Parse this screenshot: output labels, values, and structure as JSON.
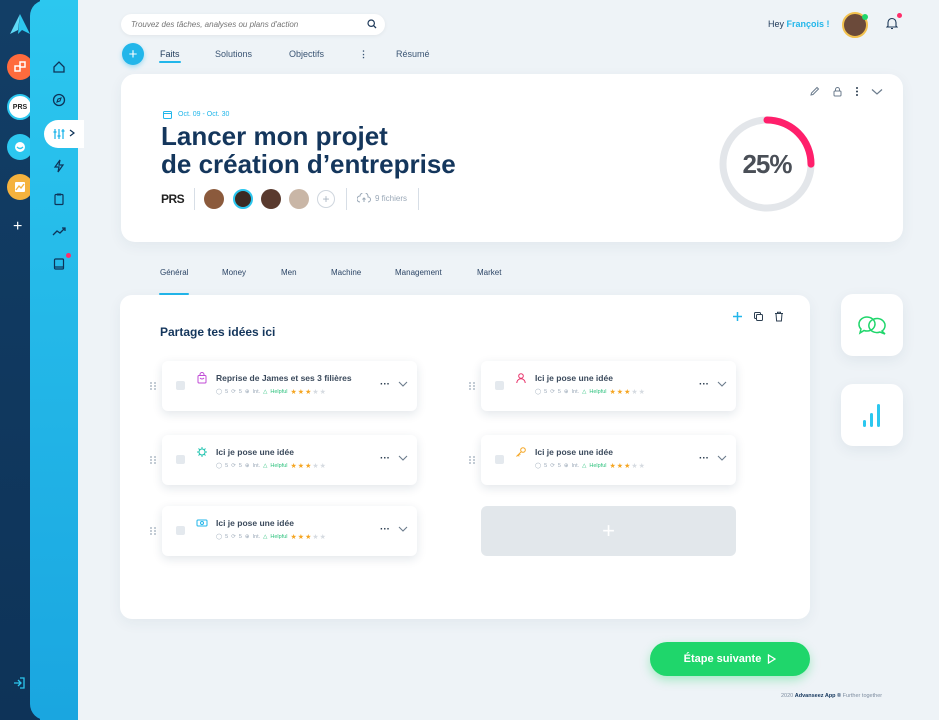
{
  "search": {
    "placeholder": "Trouvez des tâches, analyses ou plans d'action"
  },
  "header": {
    "greeting": "Hey",
    "user_name": "François !"
  },
  "top_tabs": [
    {
      "label": "Faits",
      "active": true
    },
    {
      "label": "Solutions",
      "active": false
    },
    {
      "label": "Objectifs",
      "active": false
    },
    {
      "label": "Résumé",
      "active": false
    }
  ],
  "rail_apps": [
    "PRS"
  ],
  "project": {
    "date_range": "Oct. 09 - Oct. 30",
    "title_line1": "Lancer mon projet",
    "title_line2": "de création d’entreprise",
    "org_logo": "PRS",
    "files_label": "9 fichiers",
    "progress_text": "25%",
    "progress": 0.25
  },
  "section_tabs": [
    {
      "label": "Général",
      "active": true
    },
    {
      "label": "Money",
      "active": false
    },
    {
      "label": "Men",
      "active": false
    },
    {
      "label": "Machine",
      "active": false
    },
    {
      "label": "Management",
      "active": false
    },
    {
      "label": "Market",
      "active": false
    }
  ],
  "board": {
    "title": "Partage tes idées ici",
    "ideas": [
      {
        "title": "Reprise de James et ses 3 filières",
        "icon": "bag-icon",
        "comments": "5",
        "shares": "5",
        "label": "Int.",
        "tag": "Helpful",
        "rating": 3
      },
      {
        "title": "Ici je pose une idée",
        "icon": "person-icon",
        "comments": "5",
        "shares": "5",
        "label": "Int.",
        "tag": "Helpful",
        "rating": 3
      },
      {
        "title": "Ici je pose une idée",
        "icon": "chip-icon",
        "comments": "5",
        "shares": "5",
        "label": "Int.",
        "tag": "Helpful",
        "rating": 3
      },
      {
        "title": "Ici je pose une idée",
        "icon": "key-icon",
        "comments": "5",
        "shares": "5",
        "label": "Int.",
        "tag": "Helpful",
        "rating": 3
      },
      {
        "title": "Ici je pose une idée",
        "icon": "money-icon",
        "comments": "5",
        "shares": "5",
        "label": "Int.",
        "tag": "Helpful",
        "rating": 3
      }
    ],
    "add_symbol": "+"
  },
  "actions": {
    "next_label": "Étape suivante"
  },
  "footer": {
    "year": "2020",
    "brand": "Advanseez App ®",
    "tagline": "Further together"
  },
  "colors": {
    "accent": "#22b6ea",
    "success": "#1fd66b",
    "progress": "#ff1f6b",
    "navy": "#14365c"
  }
}
